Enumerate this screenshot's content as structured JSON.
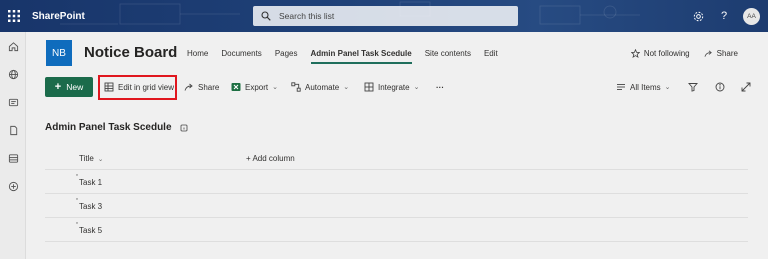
{
  "suitebar": {
    "app_name": "SharePoint",
    "search_placeholder": "Search this list",
    "help_label": "?",
    "avatar_initials": "AA"
  },
  "site": {
    "logo_initials": "NB",
    "title": "Notice Board",
    "nav": [
      "Home",
      "Documents",
      "Pages",
      "Admin Panel Task Scedule",
      "Site contents",
      "Edit"
    ],
    "active_nav_index": 3,
    "follow_label": "Not following",
    "share_label": "Share"
  },
  "commandbar": {
    "new_label": "New",
    "edit_grid_label": "Edit in grid view",
    "share_label": "Share",
    "export_label": "Export",
    "automate_label": "Automate",
    "integrate_label": "Integrate",
    "more_label": "···",
    "view_label": "All Items"
  },
  "list": {
    "title": "Admin Panel Task Scedule",
    "columns": {
      "title": "Title",
      "add_column": "+ Add column"
    },
    "new_marker": "*",
    "rows": [
      {
        "title": "Task 1"
      },
      {
        "title": "Task 3"
      },
      {
        "title": "Task 5"
      }
    ]
  },
  "colors": {
    "suitebar": "#1f4178",
    "new_button": "#1b6b4b",
    "highlight": "#e0161e",
    "logo": "#0f6cbd"
  }
}
